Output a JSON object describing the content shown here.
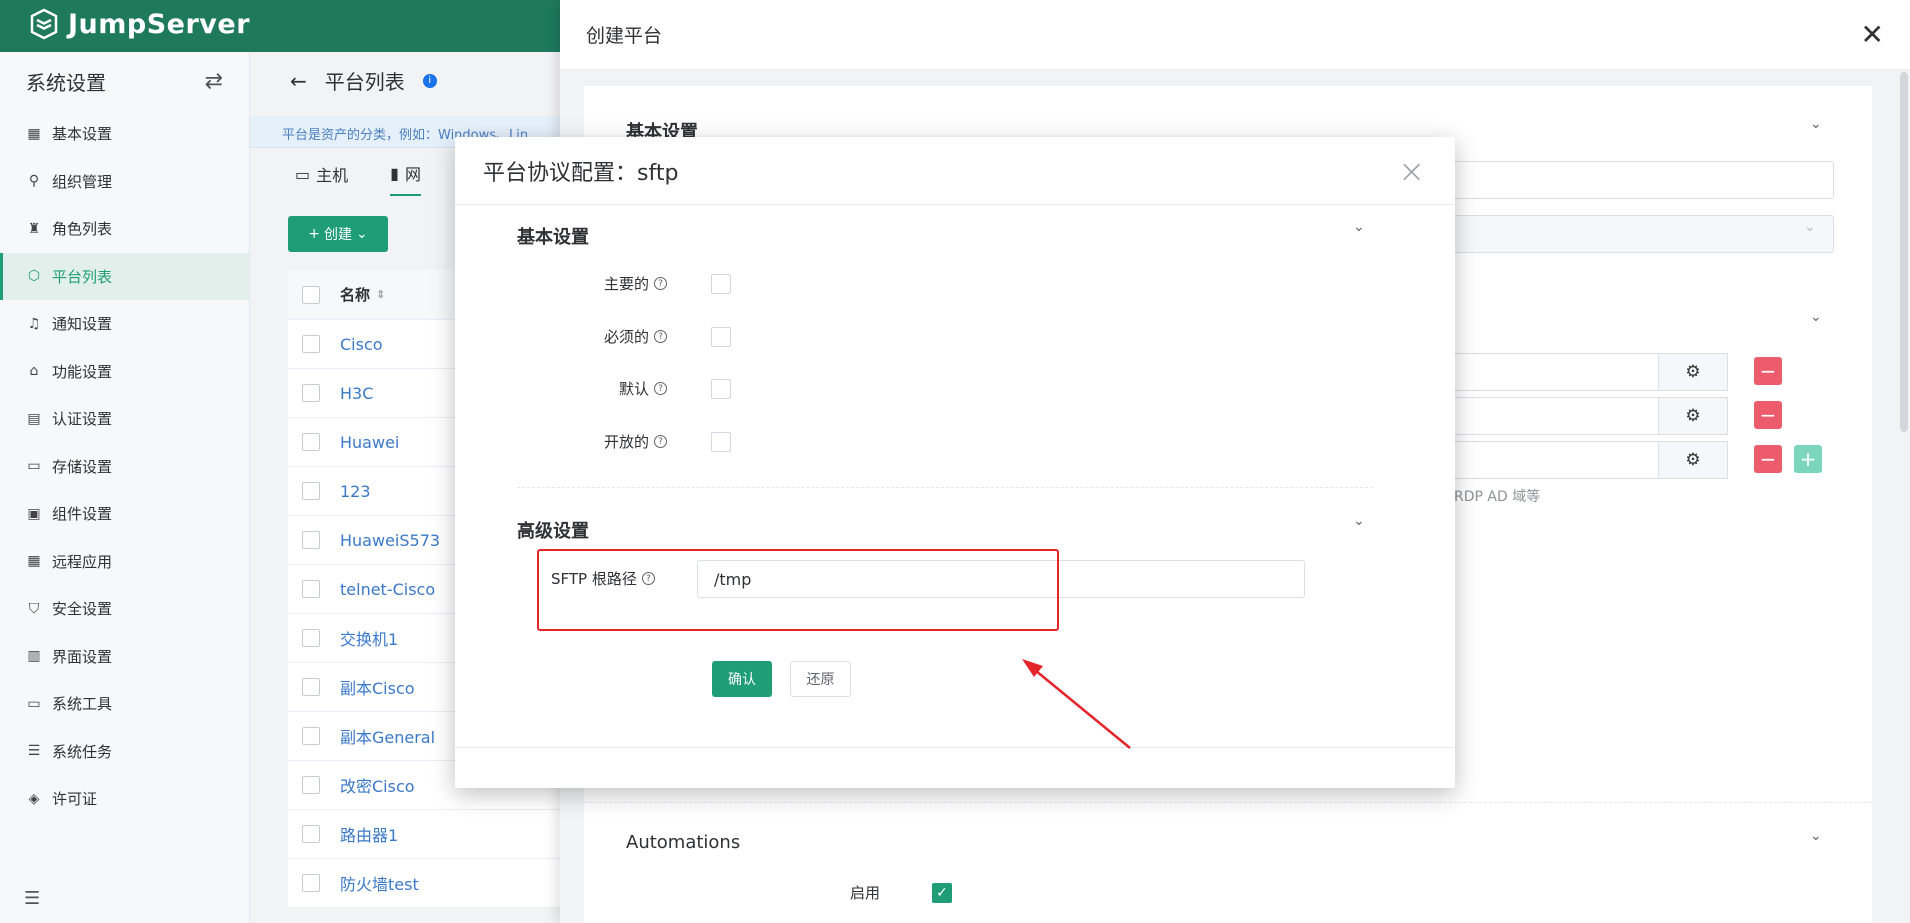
{
  "brand": {
    "logo_text": "JumpServer"
  },
  "sidebar": {
    "title": "系统设置",
    "items": [
      {
        "label": "基本设置",
        "icon": "grid-icon"
      },
      {
        "label": "组织管理",
        "icon": "org-icon"
      },
      {
        "label": "角色列表",
        "icon": "shirt-icon"
      },
      {
        "label": "平台列表",
        "icon": "cube-icon",
        "active": true
      },
      {
        "label": "通知设置",
        "icon": "bell-icon"
      },
      {
        "label": "功能设置",
        "icon": "feature-icon"
      },
      {
        "label": "认证设置",
        "icon": "id-card-icon"
      },
      {
        "label": "存储设置",
        "icon": "storage-icon"
      },
      {
        "label": "组件设置",
        "icon": "monitor-icon"
      },
      {
        "label": "远程应用",
        "icon": "apps-icon"
      },
      {
        "label": "安全设置",
        "icon": "shield-icon"
      },
      {
        "label": "界面设置",
        "icon": "layout-icon"
      },
      {
        "label": "系统工具",
        "icon": "toolbox-icon"
      },
      {
        "label": "系统任务",
        "icon": "tasks-icon"
      },
      {
        "label": "许可证",
        "icon": "license-icon"
      }
    ]
  },
  "page": {
    "title": "平台列表",
    "banner": "平台是资产的分类，例如：Windows、Lin",
    "tabs": [
      "主机",
      "网"
    ],
    "create_label": "创建",
    "table": {
      "header": "名称",
      "rows": [
        "Cisco",
        "H3C",
        "Huawei",
        "123",
        "HuaweiS573",
        "telnet-Cisco",
        "交换机1",
        "副本Cisco",
        "副本General",
        "改密Cisco",
        "路由器1",
        "防火墙test"
      ]
    }
  },
  "drawer": {
    "title": "创建平台",
    "section_basic": "基本设置",
    "hint": "RDP AD 域等",
    "section_auto": "Automations",
    "enable_label": "启用"
  },
  "modal": {
    "title": "平台协议配置：sftp",
    "section_basic": "基本设置",
    "fields": [
      "主要的",
      "必须的",
      "默认",
      "开放的"
    ],
    "section_advanced": "高级设置",
    "sftp_label": "SFTP 根路径",
    "sftp_value": "/tmp",
    "confirm_label": "确认",
    "reset_label": "还原"
  },
  "colors": {
    "brand": "#1f7a5c",
    "accent": "#1f9d74",
    "danger": "#ec5c6c",
    "highlight": "#e4252c"
  }
}
